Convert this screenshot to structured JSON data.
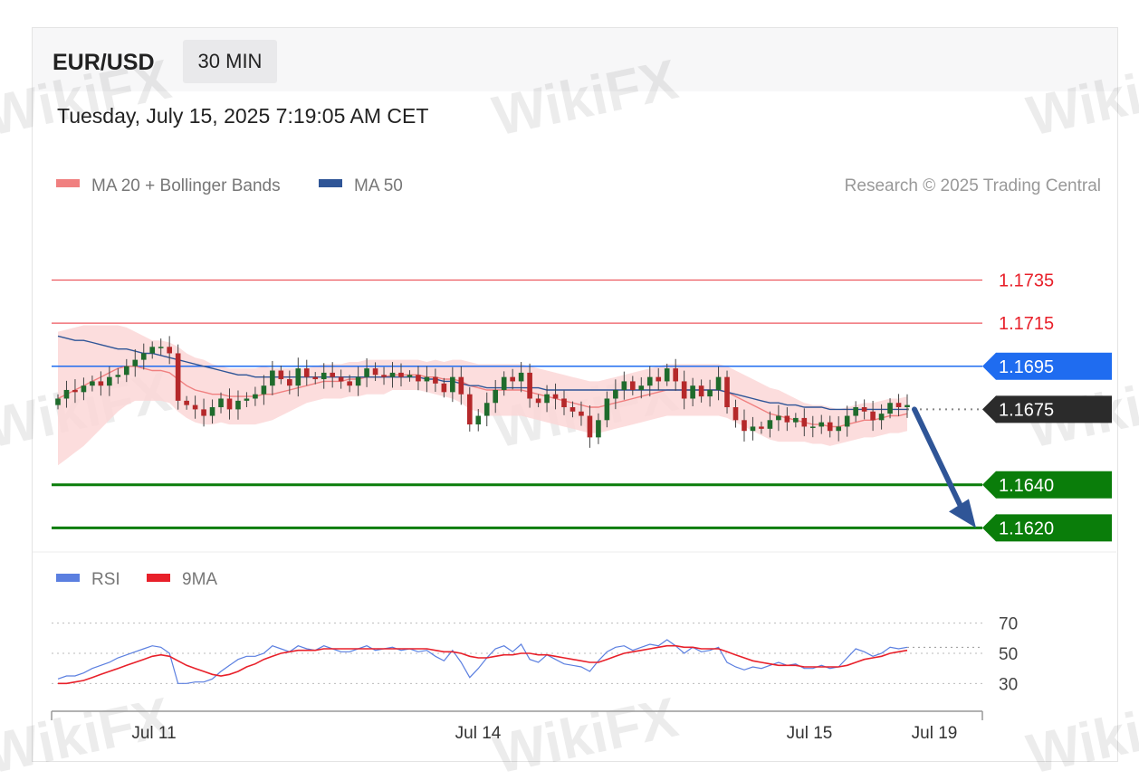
{
  "header": {
    "pair": "EUR/USD",
    "timeframe": "30 MIN",
    "timestamp": "Tuesday, July 15, 2025 7:19:05 AM CET"
  },
  "legend": {
    "items": [
      {
        "label": "MA 20 + Bollinger Bands",
        "color": "#f08080"
      },
      {
        "label": "MA 50",
        "color": "#2f5597"
      }
    ],
    "credit": "Research © 2025 Trading Central"
  },
  "rsi_legend": {
    "items": [
      {
        "label": "RSI",
        "color": "#5b7fe0"
      },
      {
        "label": "9MA",
        "color": "#e8202a"
      }
    ]
  },
  "colors": {
    "resistance": "#e8202a",
    "pivot": "#1f6cf0",
    "current": "#2b2b2b",
    "support": "#0a7d0a",
    "candle_up": "#1f6b2c",
    "candle_down": "#b5282a",
    "band_fill": "#fbd7d7",
    "ma20": "#f08080",
    "ma50": "#2f5597",
    "arrow": "#2f5597"
  },
  "watermark": "WikiFX",
  "chart_data": [
    {
      "type": "candlestick",
      "title": "EUR/USD",
      "timeframe": "30 MIN",
      "x_ticks": [
        "Jul 11",
        "Jul 14",
        "Jul 15",
        "Jul 19"
      ],
      "ylim": [
        1.1608,
        1.1765
      ],
      "levels": [
        {
          "value": 1.1735,
          "label": "1.1735",
          "kind": "resistance"
        },
        {
          "value": 1.1715,
          "label": "1.1715",
          "kind": "resistance"
        },
        {
          "value": 1.1695,
          "label": "1.1695",
          "kind": "pivot"
        },
        {
          "value": 1.1675,
          "label": "1.1675",
          "kind": "current"
        },
        {
          "value": 1.164,
          "label": "1.1640",
          "kind": "support"
        },
        {
          "value": 1.162,
          "label": "1.1620",
          "kind": "support"
        }
      ],
      "forecast": {
        "from": 1.1675,
        "to": 1.162,
        "direction": "down"
      },
      "closes": [
        1.168,
        1.1684,
        1.1683,
        1.1686,
        1.1688,
        1.1686,
        1.169,
        1.1691,
        1.1695,
        1.1698,
        1.1701,
        1.1704,
        1.1704,
        1.1701,
        1.1679,
        1.1677,
        1.1675,
        1.1672,
        1.1676,
        1.168,
        1.1675,
        1.1679,
        1.168,
        1.1682,
        1.1686,
        1.1693,
        1.1689,
        1.1686,
        1.1694,
        1.169,
        1.1689,
        1.1692,
        1.169,
        1.1688,
        1.1686,
        1.169,
        1.1694,
        1.1691,
        1.169,
        1.1692,
        1.169,
        1.1691,
        1.1688,
        1.169,
        1.1687,
        1.1683,
        1.169,
        1.1682,
        1.1668,
        1.1672,
        1.1678,
        1.1684,
        1.169,
        1.1688,
        1.1692,
        1.168,
        1.1678,
        1.1682,
        1.168,
        1.1676,
        1.1674,
        1.1672,
        1.1662,
        1.167,
        1.168,
        1.1684,
        1.1688,
        1.1684,
        1.1686,
        1.169,
        1.1688,
        1.1694,
        1.1688,
        1.168,
        1.1686,
        1.1681,
        1.1684,
        1.169,
        1.1676,
        1.167,
        1.1665,
        1.1667,
        1.1666,
        1.167,
        1.1672,
        1.1669,
        1.1671,
        1.1667,
        1.1667,
        1.1669,
        1.1665,
        1.1667,
        1.1672,
        1.1676,
        1.1674,
        1.167,
        1.1673,
        1.1678,
        1.1676,
        1.1677
      ],
      "ma20": [
        1.168,
        1.1682,
        1.1684,
        1.1686,
        1.1688,
        1.169,
        1.1692,
        1.1694,
        1.1695,
        1.1695,
        1.1694,
        1.1693,
        1.1693,
        1.1692,
        1.1689,
        1.1686,
        1.1684,
        1.1683,
        1.1682,
        1.1682,
        1.1681,
        1.1681,
        1.1681,
        1.1681,
        1.1682,
        1.1682,
        1.1683,
        1.1684,
        1.1685,
        1.1686,
        1.1687,
        1.1688,
        1.1688,
        1.1688,
        1.1689,
        1.1689,
        1.169,
        1.169,
        1.169,
        1.1691,
        1.1691,
        1.1691,
        1.1691,
        1.169,
        1.169,
        1.1689,
        1.1689,
        1.1688,
        1.1686,
        1.1685,
        1.1684,
        1.1684,
        1.1684,
        1.1684,
        1.1684,
        1.1683,
        1.1682,
        1.1681,
        1.168,
        1.1679,
        1.1678,
        1.1677,
        1.1676,
        1.1676,
        1.1677,
        1.1678,
        1.1679,
        1.168,
        1.1681,
        1.1682,
        1.1683,
        1.1684,
        1.1684,
        1.1684,
        1.1684,
        1.1684,
        1.1684,
        1.1684,
        1.1683,
        1.1681,
        1.1679,
        1.1677,
        1.1675,
        1.1673,
        1.1672,
        1.1671,
        1.167,
        1.1669,
        1.1668,
        1.1668,
        1.1667,
        1.1667,
        1.1668,
        1.1669,
        1.167,
        1.167,
        1.1671,
        1.1672,
        1.1672,
        1.1673
      ],
      "ma50": [
        1.1709,
        1.1708,
        1.1707,
        1.1707,
        1.1706,
        1.1705,
        1.1704,
        1.1703,
        1.1703,
        1.1702,
        1.1701,
        1.1701,
        1.17,
        1.1699,
        1.1698,
        1.1697,
        1.1696,
        1.1695,
        1.1694,
        1.1693,
        1.1692,
        1.1691,
        1.1691,
        1.169,
        1.169,
        1.169,
        1.169,
        1.169,
        1.169,
        1.169,
        1.169,
        1.169,
        1.169,
        1.169,
        1.169,
        1.169,
        1.169,
        1.169,
        1.169,
        1.169,
        1.169,
        1.169,
        1.169,
        1.1689,
        1.1689,
        1.1688,
        1.1688,
        1.1687,
        1.1686,
        1.1686,
        1.1685,
        1.1685,
        1.1685,
        1.1685,
        1.1685,
        1.1685,
        1.1685,
        1.1684,
        1.1684,
        1.1684,
        1.1684,
        1.1684,
        1.1684,
        1.1684,
        1.1684,
        1.1684,
        1.1684,
        1.1684,
        1.1684,
        1.1684,
        1.1684,
        1.1684,
        1.1684,
        1.1684,
        1.1684,
        1.1684,
        1.1684,
        1.1684,
        1.1683,
        1.1682,
        1.1681,
        1.168,
        1.1679,
        1.1678,
        1.1678,
        1.1677,
        1.1677,
        1.1676,
        1.1676,
        1.1676,
        1.1675,
        1.1675,
        1.1675,
        1.1675,
        1.1675,
        1.1675,
        1.1675,
        1.1675,
        1.1675,
        1.1675
      ],
      "bb_width": [
        0.0031,
        0.003,
        0.0029,
        0.0028,
        0.0026,
        0.0024,
        0.0022,
        0.002,
        0.0018,
        0.0016,
        0.0015,
        0.0014,
        0.0014,
        0.0014,
        0.0015,
        0.0015,
        0.0015,
        0.0015,
        0.0014,
        0.0013,
        0.0013,
        0.0013,
        0.0013,
        0.0013,
        0.0013,
        0.0012,
        0.0011,
        0.001,
        0.0009,
        0.0008,
        0.0008,
        0.0008,
        0.0008,
        0.0008,
        0.0008,
        0.0008,
        0.0008,
        0.0008,
        0.0008,
        0.0007,
        0.0007,
        0.0007,
        0.0007,
        0.0007,
        0.0008,
        0.0008,
        0.0009,
        0.001,
        0.0011,
        0.0011,
        0.0012,
        0.0012,
        0.0012,
        0.0012,
        0.0012,
        0.0012,
        0.0012,
        0.0012,
        0.0012,
        0.0012,
        0.0012,
        0.0012,
        0.0012,
        0.0012,
        0.0012,
        0.0012,
        0.0012,
        0.0012,
        0.0012,
        0.0012,
        0.0012,
        0.0012,
        0.0012,
        0.0012,
        0.0012,
        0.0012,
        0.0012,
        0.0012,
        0.0012,
        0.0012,
        0.0012,
        0.0012,
        0.0012,
        0.0012,
        0.0012,
        0.0011,
        0.001,
        0.0009,
        0.0009,
        0.0009,
        0.0009,
        0.0008,
        0.0008,
        0.0008,
        0.0008,
        0.0008,
        0.0008,
        0.0008,
        0.0008,
        0.0008
      ]
    },
    {
      "type": "line",
      "title": "RSI",
      "ylim": [
        20,
        80
      ],
      "y_ticks": [
        70,
        50,
        30
      ],
      "series": [
        {
          "name": "RSI",
          "values": [
            33,
            35,
            35,
            37,
            40,
            42,
            44,
            47,
            49,
            51,
            53,
            55,
            54,
            50,
            30,
            30,
            31,
            31,
            33,
            38,
            42,
            46,
            48,
            48,
            50,
            55,
            53,
            51,
            55,
            53,
            52,
            55,
            53,
            51,
            51,
            53,
            55,
            52,
            53,
            54,
            52,
            53,
            51,
            52,
            48,
            45,
            52,
            44,
            34,
            40,
            47,
            53,
            55,
            51,
            56,
            46,
            44,
            49,
            46,
            43,
            42,
            41,
            38,
            45,
            51,
            54,
            55,
            52,
            54,
            56,
            55,
            59,
            55,
            50,
            54,
            51,
            52,
            54,
            44,
            41,
            39,
            41,
            40,
            42,
            44,
            42,
            43,
            40,
            40,
            42,
            40,
            41,
            47,
            53,
            51,
            48,
            50,
            54,
            53,
            54
          ]
        },
        {
          "name": "9MA",
          "values": [
            30,
            30,
            31,
            32,
            34,
            36,
            38,
            40,
            42,
            44,
            46,
            48,
            49,
            48,
            45,
            42,
            40,
            38,
            36,
            35,
            36,
            38,
            41,
            43,
            46,
            48,
            50,
            51,
            52,
            52,
            52,
            53,
            53,
            53,
            53,
            53,
            53,
            53,
            53,
            53,
            53,
            53,
            53,
            53,
            52,
            51,
            51,
            50,
            48,
            47,
            47,
            48,
            49,
            49,
            50,
            50,
            49,
            49,
            48,
            47,
            46,
            45,
            44,
            44,
            46,
            48,
            50,
            51,
            52,
            53,
            54,
            55,
            55,
            54,
            54,
            53,
            53,
            53,
            51,
            49,
            47,
            45,
            44,
            43,
            42,
            42,
            42,
            41,
            41,
            41,
            41,
            41,
            42,
            44,
            46,
            47,
            48,
            50,
            51,
            52
          ]
        }
      ]
    }
  ]
}
